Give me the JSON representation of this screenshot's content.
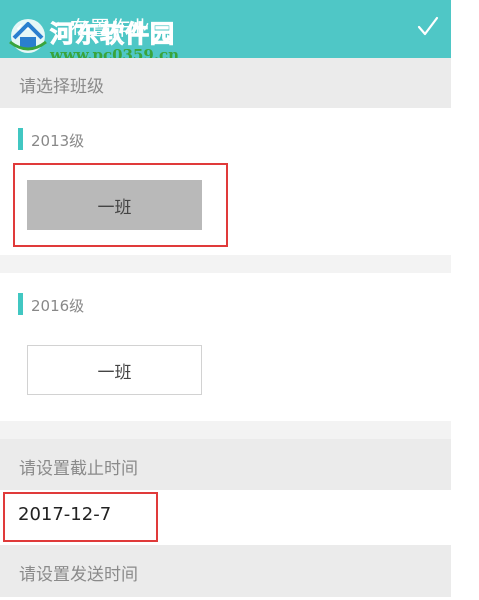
{
  "header": {
    "back_glyph": "←",
    "title": "布置作业",
    "confirm_icon": "check-icon",
    "background_color": "#4fc7c6"
  },
  "watermark": {
    "name": "河东软件园",
    "url": "www.pc0359.cn"
  },
  "class_section": {
    "label": "请选择班级"
  },
  "grades": [
    {
      "label": "2013级",
      "classes": [
        {
          "label": "一班",
          "selected": true
        }
      ]
    },
    {
      "label": "2016级",
      "classes": [
        {
          "label": "一班",
          "selected": false
        }
      ]
    }
  ],
  "deadline": {
    "label": "请设置截止时间",
    "value": "2017-12-7"
  },
  "send_time": {
    "label": "请设置发送时间"
  },
  "colors": {
    "accent": "#41c7c2",
    "highlight_box": "#e03a3a",
    "selected_class": "#b9b9b9"
  }
}
